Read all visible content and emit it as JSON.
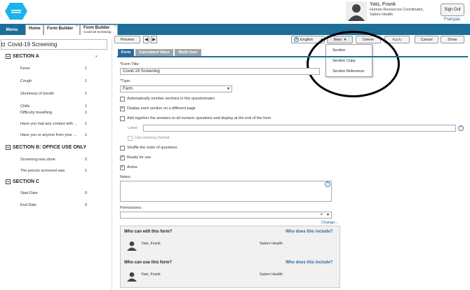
{
  "header": {
    "user_name": "Yatz, Frank",
    "user_role_line1": "Human Resources Coordinator,",
    "user_role_line2": "Salem Health",
    "signout": "Sign Out",
    "language_link": "Français"
  },
  "tabs": {
    "menu": "Menu",
    "home": "Home",
    "form_builder_1": "Form Builder",
    "form_builder_2": "Form Builder",
    "form_builder_2_sub": "Covid-19 Screening"
  },
  "left": {
    "title": "Covid-19 Screening",
    "section_a": "SECTION A",
    "section_b": "SECTION B: OFFICE USE ONLY",
    "section_c": "SECTION C",
    "a_items": [
      {
        "label": "Fever",
        "n": "1"
      },
      {
        "label": "Cough",
        "n": "1"
      },
      {
        "label": "Shortness of breath",
        "n": "1"
      },
      {
        "label": "Chills",
        "n": "1"
      },
      {
        "label": "Difficulty breathing",
        "n": "1"
      },
      {
        "label": "Have you had any contact with ...",
        "n": "1"
      },
      {
        "label": "Have you or anyone from your ...",
        "n": "1"
      }
    ],
    "b_items": [
      {
        "label": "Screening was done",
        "n": "0"
      },
      {
        "label": "The person screened was",
        "n": "1"
      }
    ],
    "c_items": [
      {
        "label": "Start Date",
        "n": "0"
      },
      {
        "label": "End Date",
        "n": "0"
      }
    ]
  },
  "toolbar": {
    "preview": "Preview",
    "language": "English",
    "new": "New",
    "delete": "Delete",
    "apply": "Apply",
    "cancel": "Cancel",
    "done": "Done"
  },
  "new_menu": [
    "Section",
    "Section Copy",
    "Section Reference"
  ],
  "form_tabs": {
    "form": "Form",
    "calculated": "Calculated Value",
    "multiuser": "Multi-User"
  },
  "form": {
    "title_label": "*Form Title:",
    "title_value": "Covid-19 Screening",
    "type_label": "*Type:",
    "type_value": "Form",
    "cb_autonum": "Automatically number sections in this questionnaire",
    "cb_each_section": "Display each section on a different page",
    "cb_add_together": "Add together the answers to all numeric questions and display at the end of the form",
    "label_label": "Label:",
    "cb_currency": "Use currency format",
    "cb_shuffle": "Shuffle the order of questions",
    "cb_ready": "Ready for use",
    "cb_active": "Active",
    "notes_label": "Notes:",
    "permissions_label": "Permissions:",
    "change": "Change..."
  },
  "perms": {
    "edit_heading": "Who can edit this form?",
    "edit_link": "Who does this include?",
    "edit_person": "Yatz, Frank",
    "edit_org": "Salem Health",
    "use_heading": "Who can use this form?",
    "use_link": "Who does this include?",
    "use_person": "Yatz, Frank",
    "use_org": "Salem Health"
  },
  "colors": {
    "brand_blue": "#1d6f99",
    "tab_active": "#2b6a9c",
    "tab_inactive": "#9ea5aa",
    "logo": "#19b4ea"
  }
}
